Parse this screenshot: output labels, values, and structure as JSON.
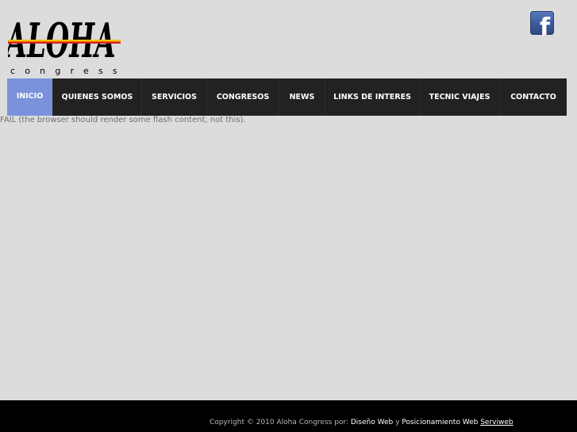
{
  "brand": {
    "logo_main": "ALOHA",
    "logo_sub": "congress"
  },
  "social": {
    "facebook_glyph": "f"
  },
  "nav": {
    "items": [
      {
        "label": "INICIO"
      },
      {
        "label": "QUIENES SOMOS"
      },
      {
        "label": "SERVICIOS"
      },
      {
        "label": "CONGRESOS"
      },
      {
        "label": "NEWS"
      },
      {
        "label": "LINKS DE INTERES"
      },
      {
        "label": "TECNIC VIAJES"
      },
      {
        "label": "CONTACTO"
      }
    ]
  },
  "content": {
    "flash_fallback": "FAIL (the browser should render some flash content, not this)."
  },
  "footer": {
    "copyright": "Copyright © 2010 Aloha Congress por:",
    "link1": "Diseño Web",
    "connector": "y",
    "link2": "Posicionamiento Web",
    "link3": "Serviweb"
  },
  "colors": {
    "background": "#dcdcdc",
    "nav_background": "#222222",
    "nav_active": "#7a92dc",
    "footer_background": "#000000",
    "facebook_blue": "#3b5998",
    "logo_red": "#d62020",
    "logo_yellow": "#f2c200"
  }
}
